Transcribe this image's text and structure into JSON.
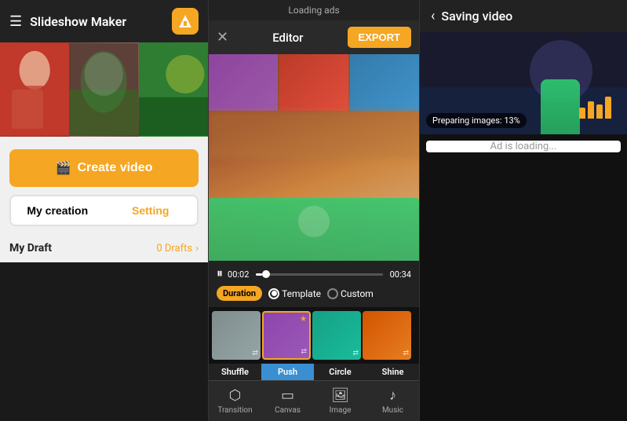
{
  "app": {
    "title": "Slideshow Maker"
  },
  "left": {
    "create_btn_label": "Create video",
    "tab_my_creation": "My creation",
    "tab_setting": "Setting",
    "drafts_title": "My Draft",
    "drafts_count": "0 Drafts"
  },
  "editor": {
    "title": "Editor",
    "export_label": "EXPORT",
    "time_start": "00:02",
    "time_end": "00:34",
    "duration_label": "Duration",
    "template_label": "Template",
    "custom_label": "Custom",
    "transition_tabs": [
      "Shuffle",
      "Push",
      "Circle",
      "Shine"
    ],
    "active_tab": "Push"
  },
  "toolbar": {
    "transition_label": "Transition",
    "canvas_label": "Canvas",
    "image_label": "Image",
    "music_label": "Music"
  },
  "right": {
    "back_icon": "‹",
    "saving_title": "Saving video",
    "progress_text": "Preparing images: 13%",
    "ad_loading": "Ad is loading..."
  },
  "top_bar": {
    "loading_ads_text": "Loading ads"
  }
}
